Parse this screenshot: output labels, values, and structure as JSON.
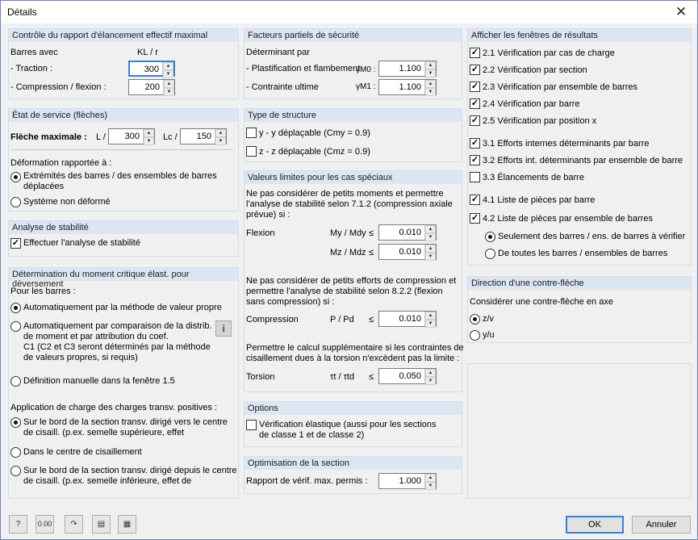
{
  "window": {
    "title": "Détails",
    "close_icon": "close-icon"
  },
  "p1": {
    "header": "Contrôle du rapport d'élancement effectif maximal",
    "barres_avec": "Barres avec",
    "kl_r": "KL / r",
    "traction_label": "- Traction :",
    "traction_value": "300",
    "compression_label": "- Compression / flexion :",
    "compression_value": "200"
  },
  "p2": {
    "header": "État de service (flèches)",
    "fleche_label": "Flèche maximale :",
    "l_label1": "L /",
    "l_value": "300",
    "lc_label": "Lc /",
    "lc_value": "150",
    "deformation_label": "Déformation rapportée à :",
    "opt1": "Extrémités des barres / des ensembles de barres",
    "opt1b": "déplacées",
    "opt2": "Système non déformé"
  },
  "p3": {
    "header": "Analyse de stabilité",
    "cb_label": "Effectuer l'analyse de stabilité"
  },
  "p4": {
    "header": "Détermination du moment critique élast. pour déversement",
    "pour_barres": "Pour les barres :",
    "opt1": "Automatiquement par la méthode de valeur propre",
    "opt2_l1": "Automatiquement par comparaison de la distrib.",
    "opt2_l2": "de moment et par attribution du coef.",
    "opt2_l3": "C1 (C2 et C3 seront déterminés par la méthode",
    "opt2_l4": "de valeurs propres, si requis)",
    "opt3": "Définition manuelle dans la fenêtre 1.5",
    "app_label": "Application de charge des charges transv. positives :",
    "a1_l1": "Sur le bord de la section transv. dirigé vers le centre",
    "a1_l2": "de cisaill. (p.ex. semelle supérieure, effet",
    "a2": "Dans le centre de cisaillement",
    "a3_l1": "Sur le bord de la section transv. dirigé depuis le centre",
    "a3_l2": "de cisaill. (p.ex. semelle inférieure, effet de"
  },
  "p5": {
    "header": "Facteurs partiels de sécurité",
    "determinant": "Déterminant par",
    "plast_label": "- Plastification et flambement",
    "gm0": "γM0 :",
    "plast_value": "1.100",
    "ultime_label": "- Contrainte ultime",
    "gm1": "γM1 :",
    "ultime_value": "1.100"
  },
  "p6": {
    "header": "Type de structure",
    "opt1": "y - y déplaçable (Cmy = 0.9)",
    "opt2": "z - z déplaçable (Cmz = 0.9)"
  },
  "p7": {
    "header": "Valeurs limites pour les cas spéciaux",
    "text1_l1": "Ne pas considérer de petits moments et permettre",
    "text1_l2": "l'analyse de stabilité selon 7.1.2 (compression axiale",
    "text1_l3": "prévue) si :",
    "flexion": "Flexion",
    "my_label": "My / Mdy",
    "my_leq": "≤",
    "my_value": "0.010",
    "mz_label": "Mz / Mdz",
    "mz_leq": "≤",
    "mz_value": "0.010",
    "text2_l1": "Ne pas considérer de petits efforts de compression et",
    "text2_l2": "permettre l'analyse de stabilité selon 8.2.2 (flexion",
    "text2_l3": "sans compression) si :",
    "compression": "Compression",
    "p_label": "P / Pd",
    "p_leq": "≤",
    "p_value": "0.010",
    "text3_l1": "Permettre le calcul supplémentaire si les contraintes de",
    "text3_l2": "cisaillement dues à la torsion n'excèdent pas la limite :",
    "torsion": "Torsion",
    "t_label": "τt / τtd",
    "t_leq": "≤",
    "t_value": "0.050"
  },
  "p8": {
    "header": "Options",
    "cb_l1": "Vérification élastique (aussi pour les sections",
    "cb_l2": "de classe 1 et de classe 2)"
  },
  "p9": {
    "header": "Optimisation de la section",
    "label": "Rapport de vérif. max. permis :",
    "value": "1.000"
  },
  "p10": {
    "header": "Afficher les fenêtres de résultats",
    "items": [
      "2.1 Vérification par cas de charge",
      "2.2 Vérification par section",
      "2.3 Vérification par ensemble de barres",
      "2.4 Vérification par barre",
      "2.5 Vérification par position x",
      "3.1 Efforts internes déterminants par barre",
      "3.2 Efforts int. déterminants par ensemble de barre",
      "3.3 Élancements de barre",
      "4.1 Liste de pièces par barre",
      "4.2 Liste de pièces par ensemble de barres"
    ],
    "checks": [
      "✓",
      "✓",
      "✓",
      "✓",
      "✓",
      "✓",
      "✓",
      "",
      "✓",
      "✓"
    ],
    "r1": "Seulement des barres / ens. de barres à vérifier",
    "r2": "De toutes les barres / ensembles de barres"
  },
  "p11": {
    "header": "Direction d'une contre-flèche",
    "label": "Considérer une contre-flèche en axe",
    "opt1": "z/v",
    "opt2": "y/u"
  },
  "footer": {
    "ok": "OK",
    "cancel": "Annuler",
    "tool2_label": "0.00"
  }
}
